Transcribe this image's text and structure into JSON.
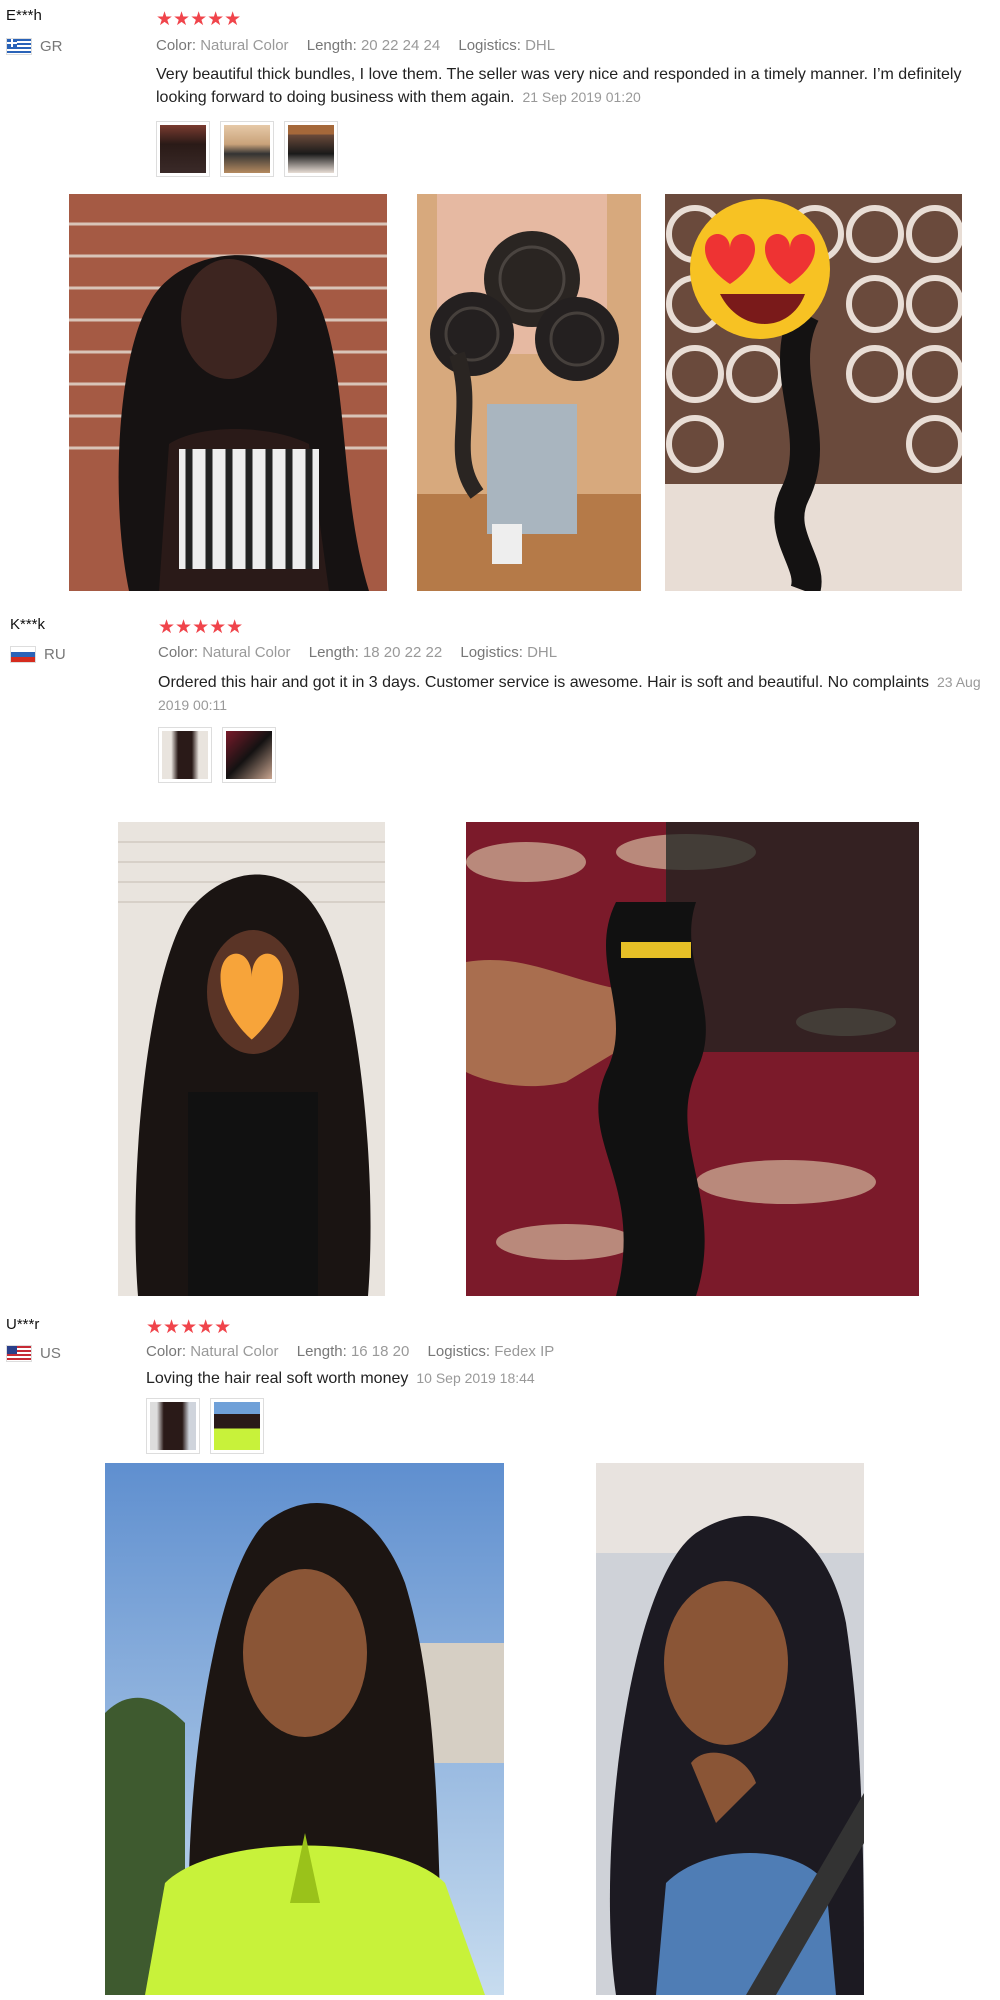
{
  "labels": {
    "color": "Color:",
    "length": "Length:",
    "logistics": "Logistics:"
  },
  "reviews": [
    {
      "user": "E***h",
      "country": "GR",
      "stars": "★★★★★",
      "color": "Natural Color",
      "length": "20 22 24 24",
      "logistics": "DHL",
      "text": "Very beautiful thick bundles, I love them. The seller was very nice and responded in a timely manner. I’m definitely looking forward to doing business with them again.",
      "date": "21 Sep 2019 01:20"
    },
    {
      "user": "K***k",
      "country": "RU",
      "stars": "★★★★★",
      "color": "Natural Color",
      "length": "18 20 22 22",
      "logistics": "DHL",
      "text": "Ordered this hair and got it in 3 days. Customer service is awesome. Hair is soft and beautiful. No complaints",
      "date": "23 Aug 2019 00:11"
    },
    {
      "user": "U***r",
      "country": "US",
      "stars": "★★★★★",
      "color": "Natural Color",
      "length": "16 18 20",
      "logistics": "Fedex IP",
      "text": "Loving the hair real soft worth money",
      "date": "10 Sep 2019 18:44"
    }
  ],
  "colors": {
    "star": "#f0444b",
    "label": "#777777",
    "value": "#999999",
    "text": "#222222"
  }
}
